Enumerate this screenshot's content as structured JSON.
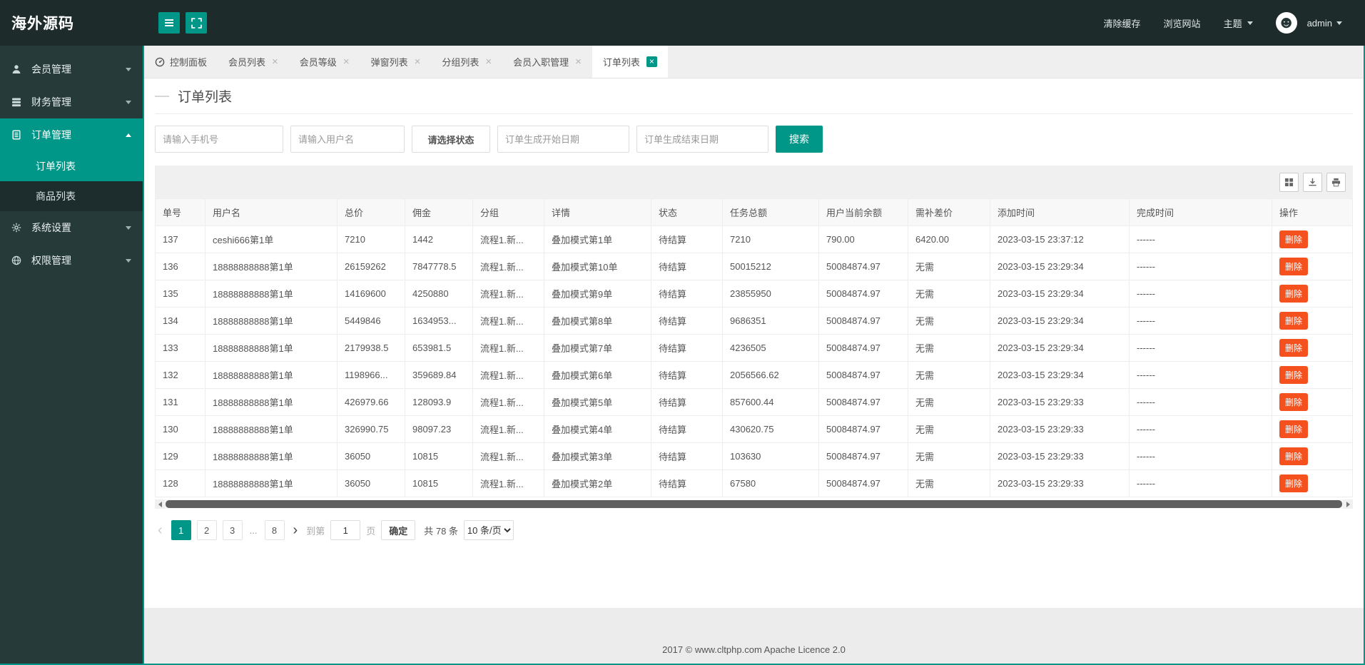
{
  "colors": {
    "accent": "#009688",
    "danger": "#f4511e",
    "header_bg": "#1e2b2b",
    "sidebar_bg": "#263a3a",
    "submenu_bg": "#1d2d2d"
  },
  "header": {
    "logo": "海外源码",
    "buttons": [
      {
        "name": "menu-toggle-button",
        "icon": "hamburger"
      },
      {
        "name": "fullscreen-button",
        "icon": "expand"
      }
    ],
    "clear_cache": "清除缓存",
    "browse_site": "浏览网站",
    "theme": "主题",
    "user": "admin"
  },
  "sidebar": {
    "items": [
      {
        "id": "member-management",
        "label": "会员管理",
        "icon": "user",
        "expanded": false,
        "active": false
      },
      {
        "id": "finance-management",
        "label": "财务管理",
        "icon": "finance",
        "expanded": false,
        "active": false
      },
      {
        "id": "order-management",
        "label": "订单管理",
        "icon": "order",
        "expanded": true,
        "active": true,
        "children": [
          {
            "id": "order-list",
            "label": "订单列表",
            "active": true
          },
          {
            "id": "product-list",
            "label": "商品列表",
            "active": false
          }
        ]
      },
      {
        "id": "system-settings",
        "label": "系统设置",
        "icon": "settings",
        "expanded": false,
        "active": false
      },
      {
        "id": "permission-management",
        "label": "权限管理",
        "icon": "permission",
        "expanded": false,
        "active": false
      }
    ]
  },
  "tabs": [
    {
      "id": "dashboard",
      "label": "控制面板",
      "icon": "dashboard",
      "closable": false,
      "active": false
    },
    {
      "id": "member-list",
      "label": "会员列表",
      "closable": true,
      "active": false
    },
    {
      "id": "member-level",
      "label": "会员等级",
      "closable": true,
      "active": false
    },
    {
      "id": "popup-list",
      "label": "弹窗列表",
      "closable": true,
      "active": false
    },
    {
      "id": "group-list",
      "label": "分组列表",
      "closable": true,
      "active": false
    },
    {
      "id": "member-onboarding",
      "label": "会员入职管理",
      "closable": true,
      "active": false
    },
    {
      "id": "order-list",
      "label": "订单列表",
      "closable": true,
      "active": true
    }
  ],
  "page": {
    "title": "订单列表"
  },
  "filters": {
    "phone_placeholder": "请输入手机号",
    "username_placeholder": "请输入用户名",
    "status_label": "请选择状态",
    "start_date_placeholder": "订单生成开始日期",
    "end_date_placeholder": "订单生成结束日期",
    "search_label": "搜索"
  },
  "table": {
    "toolbar_buttons": [
      {
        "name": "columns-toggle-button",
        "icon": "grid"
      },
      {
        "name": "export-button",
        "icon": "download"
      },
      {
        "name": "print-button",
        "icon": "printer"
      }
    ],
    "columns": [
      "单号",
      "用户名",
      "总价",
      "佣金",
      "分组",
      "详情",
      "状态",
      "任务总额",
      "用户当前余额",
      "需补差价",
      "添加时间",
      "完成时间",
      "操作"
    ],
    "delete_label": "删除",
    "rows": [
      [
        "137",
        "ceshi666第1单",
        "7210",
        "1442",
        "流程1.新...",
        "叠加模式第1单",
        "待结算",
        "7210",
        "790.00",
        "6420.00",
        "2023-03-15 23:37:12",
        "------"
      ],
      [
        "136",
        "18888888888第1单",
        "26159262",
        "7847778.5",
        "流程1.新...",
        "叠加模式第10单",
        "待结算",
        "50015212",
        "50084874.97",
        "无需",
        "2023-03-15 23:29:34",
        "------"
      ],
      [
        "135",
        "18888888888第1单",
        "14169600",
        "4250880",
        "流程1.新...",
        "叠加模式第9单",
        "待结算",
        "23855950",
        "50084874.97",
        "无需",
        "2023-03-15 23:29:34",
        "------"
      ],
      [
        "134",
        "18888888888第1单",
        "5449846",
        "1634953...",
        "流程1.新...",
        "叠加模式第8单",
        "待结算",
        "9686351",
        "50084874.97",
        "无需",
        "2023-03-15 23:29:34",
        "------"
      ],
      [
        "133",
        "18888888888第1单",
        "2179938.5",
        "653981.5",
        "流程1.新...",
        "叠加模式第7单",
        "待结算",
        "4236505",
        "50084874.97",
        "无需",
        "2023-03-15 23:29:34",
        "------"
      ],
      [
        "132",
        "18888888888第1单",
        "1198966...",
        "359689.84",
        "流程1.新...",
        "叠加模式第6单",
        "待结算",
        "2056566.62",
        "50084874.97",
        "无需",
        "2023-03-15 23:29:34",
        "------"
      ],
      [
        "131",
        "18888888888第1单",
        "426979.66",
        "128093.9",
        "流程1.新...",
        "叠加模式第5单",
        "待结算",
        "857600.44",
        "50084874.97",
        "无需",
        "2023-03-15 23:29:33",
        "------"
      ],
      [
        "130",
        "18888888888第1单",
        "326990.75",
        "98097.23",
        "流程1.新...",
        "叠加模式第4单",
        "待结算",
        "430620.75",
        "50084874.97",
        "无需",
        "2023-03-15 23:29:33",
        "------"
      ],
      [
        "129",
        "18888888888第1单",
        "36050",
        "10815",
        "流程1.新...",
        "叠加模式第3单",
        "待结算",
        "103630",
        "50084874.97",
        "无需",
        "2023-03-15 23:29:33",
        "------"
      ],
      [
        "128",
        "18888888888第1单",
        "36050",
        "10815",
        "流程1.新...",
        "叠加模式第2单",
        "待结算",
        "67580",
        "50084874.97",
        "无需",
        "2023-03-15 23:29:33",
        "------"
      ]
    ]
  },
  "pagination": {
    "pages": [
      "1",
      "2",
      "3",
      "...",
      "8"
    ],
    "active_page": "1",
    "goto_prefix": "到第",
    "goto_value": "1",
    "goto_suffix": "页",
    "confirm_label": "确定",
    "total_label": "共 78 条",
    "page_size_label": "10 条/页"
  },
  "footer": {
    "text": "2017 ©  www.cltphp.com  Apache Licence 2.0"
  }
}
